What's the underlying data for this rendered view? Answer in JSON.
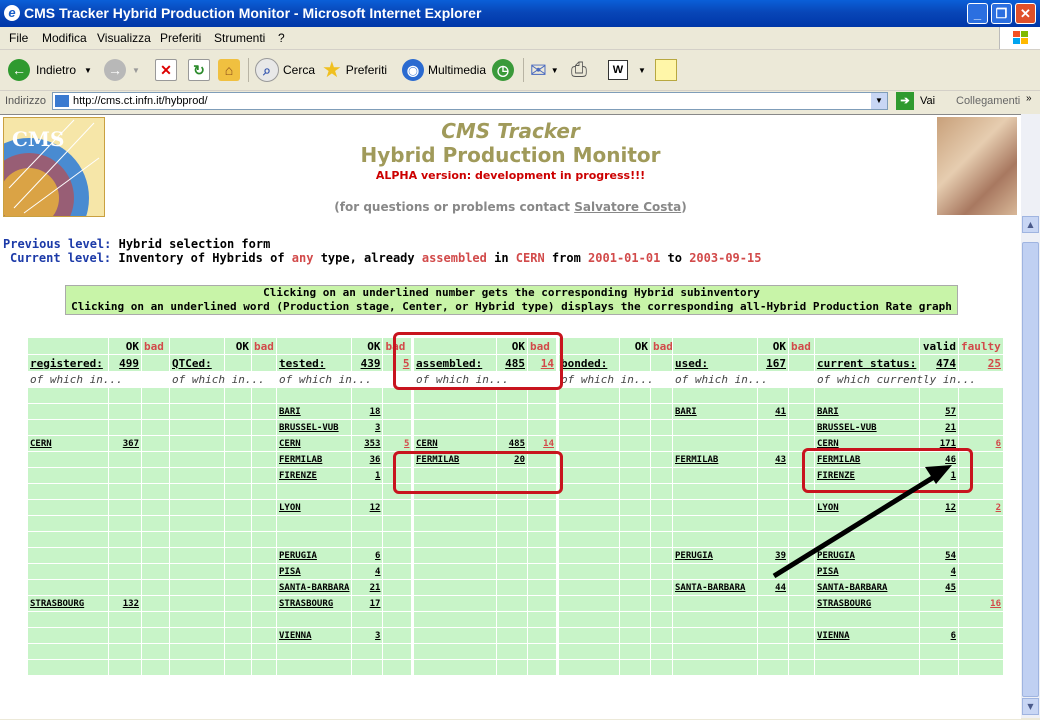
{
  "window": {
    "title": "CMS Tracker Hybrid Production Monitor - Microsoft Internet Explorer"
  },
  "menu": [
    "File",
    "Modifica",
    "Visualizza",
    "Preferiti",
    "Strumenti",
    "?"
  ],
  "toolbar": {
    "back": "Indietro",
    "search": "Cerca",
    "favorites": "Preferiti",
    "media": "Multimedia"
  },
  "address": {
    "label": "Indirizzo",
    "url": "http://cms.ct.infn.it/hybprod/",
    "go": "Vai",
    "links": "Collegamenti"
  },
  "page": {
    "title1": "CMS Tracker",
    "title2": "Hybrid Production Monitor",
    "alpha": "ALPHA version: development in progress!!!",
    "contact_pre": "(for questions or problems contact ",
    "contact_name": "Salvatore Costa",
    "contact_post": ")",
    "prev_label": "Previous level:",
    "prev_value": "Hybrid selection form",
    "cur_label": "Current level:",
    "cur_p1": "Inventory of Hybrids of ",
    "cur_any": "any",
    "cur_p2": " type, already ",
    "cur_assembled": "assembled",
    "cur_p3": " in ",
    "cur_cern": "CERN",
    "cur_p4": " from ",
    "cur_from": "2001-01-01",
    "cur_p5": " to ",
    "cur_to": "2003-09-15",
    "info1": "Clicking on an underlined number gets the corresponding Hybrid subinventory",
    "info2": "Clicking on an underlined word (Production stage, Center, or Hybrid type) displays the corresponding all-Hybrid Production Rate graph"
  },
  "columns": [
    {
      "ok": "OK",
      "bad": "bad",
      "stage": "registered:",
      "ok_total": "499",
      "bad_total": "",
      "sub": "of which in...",
      "rows": [
        [
          "",
          ""
        ],
        [
          "",
          ""
        ],
        [
          "",
          ""
        ],
        [
          "CERN",
          "367"
        ],
        [
          "",
          ""
        ],
        [
          "",
          ""
        ],
        [
          "",
          ""
        ],
        [
          "",
          ""
        ],
        [
          "",
          ""
        ],
        [
          "",
          ""
        ],
        [
          "",
          ""
        ],
        [
          "",
          ""
        ],
        [
          "",
          ""
        ],
        [
          "STRASBOURG",
          "132"
        ],
        [
          "",
          ""
        ],
        [
          "",
          ""
        ],
        [
          "",
          ""
        ],
        [
          "",
          ""
        ]
      ]
    },
    {
      "ok": "OK",
      "bad": "bad",
      "stage": "QTCed:",
      "ok_total": "",
      "bad_total": "",
      "sub": "of which in...",
      "rows": [
        [
          "",
          ""
        ],
        [
          "",
          ""
        ],
        [
          "",
          ""
        ],
        [
          "",
          ""
        ],
        [
          "",
          ""
        ],
        [
          "",
          ""
        ],
        [
          "",
          ""
        ],
        [
          "",
          ""
        ],
        [
          "",
          ""
        ],
        [
          "",
          ""
        ],
        [
          "",
          ""
        ],
        [
          "",
          ""
        ],
        [
          "",
          ""
        ],
        [
          "",
          ""
        ],
        [
          "",
          ""
        ],
        [
          "",
          ""
        ],
        [
          "",
          ""
        ],
        [
          "",
          ""
        ]
      ]
    },
    {
      "ok": "OK",
      "bad": "bad",
      "stage": "tested:",
      "ok_total": "439",
      "bad_total": "5",
      "sub": "of which in...",
      "rows": [
        [
          "",
          ""
        ],
        [
          "BARI",
          "18"
        ],
        [
          "BRUSSEL-VUB",
          "3"
        ],
        [
          "CERN",
          "353",
          "5"
        ],
        [
          "FERMILAB",
          "36"
        ],
        [
          "FIRENZE",
          "1"
        ],
        [
          "",
          ""
        ],
        [
          "LYON",
          "12"
        ],
        [
          "",
          ""
        ],
        [
          "",
          ""
        ],
        [
          "PERUGIA",
          "6"
        ],
        [
          "PISA",
          "4"
        ],
        [
          "SANTA-BARBARA",
          "21"
        ],
        [
          "STRASBOURG",
          "17"
        ],
        [
          "",
          ""
        ],
        [
          "VIENNA",
          "3"
        ],
        [
          "",
          ""
        ],
        [
          "",
          ""
        ]
      ]
    },
    {
      "ok": "OK",
      "bad": "bad",
      "stage": "assembled:",
      "ok_total": "485",
      "bad_total": "14",
      "sub": "of which in...",
      "rows": [
        [
          "",
          ""
        ],
        [
          "",
          ""
        ],
        [
          "",
          ""
        ],
        [
          "CERN",
          "485",
          "14"
        ],
        [
          "FERMILAB",
          "20"
        ],
        [
          "",
          ""
        ],
        [
          "",
          ""
        ],
        [
          "",
          ""
        ],
        [
          "",
          ""
        ],
        [
          "",
          ""
        ],
        [
          "",
          ""
        ],
        [
          "",
          ""
        ],
        [
          "",
          ""
        ],
        [
          "",
          ""
        ],
        [
          "",
          ""
        ],
        [
          "",
          ""
        ],
        [
          "",
          ""
        ],
        [
          "",
          ""
        ]
      ]
    },
    {
      "ok": "OK",
      "bad": "bad",
      "stage": "bonded:",
      "ok_total": "",
      "bad_total": "",
      "sub": "of which in...",
      "rows": [
        [
          "",
          ""
        ],
        [
          "",
          ""
        ],
        [
          "",
          ""
        ],
        [
          "",
          ""
        ],
        [
          "",
          ""
        ],
        [
          "",
          ""
        ],
        [
          "",
          ""
        ],
        [
          "",
          ""
        ],
        [
          "",
          ""
        ],
        [
          "",
          ""
        ],
        [
          "",
          ""
        ],
        [
          "",
          ""
        ],
        [
          "",
          ""
        ],
        [
          "",
          ""
        ],
        [
          "",
          ""
        ],
        [
          "",
          ""
        ],
        [
          "",
          ""
        ],
        [
          "",
          ""
        ]
      ]
    },
    {
      "ok": "OK",
      "bad": "bad",
      "stage": "used:",
      "ok_total": "167",
      "bad_total": "",
      "sub": "of which in...",
      "rows": [
        [
          "",
          ""
        ],
        [
          "BARI",
          "41"
        ],
        [
          "",
          ""
        ],
        [
          "",
          ""
        ],
        [
          "FERMILAB",
          "43"
        ],
        [
          "",
          ""
        ],
        [
          "",
          ""
        ],
        [
          "",
          ""
        ],
        [
          "",
          ""
        ],
        [
          "",
          ""
        ],
        [
          "PERUGIA",
          "39"
        ],
        [
          "",
          ""
        ],
        [
          "SANTA-BARBARA",
          "44"
        ],
        [
          "",
          ""
        ],
        [
          "",
          ""
        ],
        [
          "",
          ""
        ],
        [
          "",
          ""
        ],
        [
          "",
          ""
        ]
      ]
    },
    {
      "ok": "valid",
      "bad": "faulty",
      "stage": "current status:",
      "ok_total": "474",
      "bad_total": "25",
      "sub": "of which currently in...",
      "rows": [
        [
          "",
          ""
        ],
        [
          "BARI",
          "57"
        ],
        [
          "BRUSSEL-VUB",
          "21"
        ],
        [
          "CERN",
          "171",
          "6"
        ],
        [
          "FERMILAB",
          "46"
        ],
        [
          "FIRENZE",
          "1"
        ],
        [
          "",
          ""
        ],
        [
          "LYON",
          "12",
          "2"
        ],
        [
          "",
          ""
        ],
        [
          "",
          ""
        ],
        [
          "PERUGIA",
          "54"
        ],
        [
          "PISA",
          "4"
        ],
        [
          "SANTA-BARBARA",
          "45"
        ],
        [
          "STRASBOURG",
          "",
          "16"
        ],
        [
          "",
          ""
        ],
        [
          "VIENNA",
          "6"
        ],
        [
          "",
          ""
        ],
        [
          "",
          ""
        ]
      ]
    }
  ]
}
